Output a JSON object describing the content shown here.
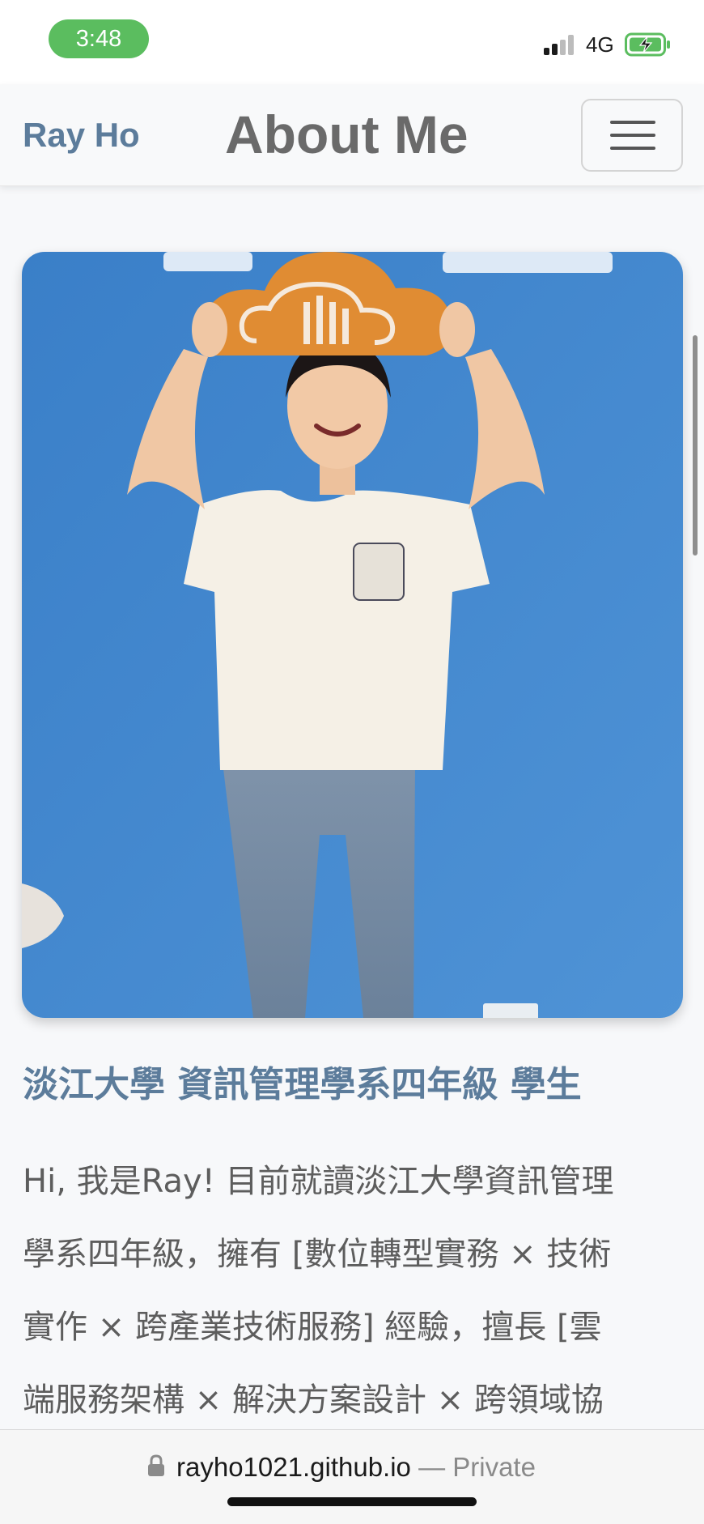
{
  "status_bar": {
    "time": "3:48",
    "network": "4G",
    "signal_icon": "cellular-signal-icon",
    "battery_icon": "battery-charging-icon",
    "time_pill_color": "#5bbd5f"
  },
  "navbar": {
    "brand": "Ray Ho",
    "title": "About Me",
    "menu_icon": "hamburger-menu-icon"
  },
  "profile": {
    "photo_description_icon": "profile-photo",
    "subtitle": "淡江大學 資訊管理學系四年級 學生",
    "bio_lines": [
      "Hi, 我是Ray! 目前就讀淡江大學資訊管理",
      "學系四年級，擁有 [數位轉型實務 × 技術",
      "實作 × 跨產業技術服務] 經驗，擅長 [雲",
      "端服務架構 × 解決方案設計 × 跨領域協"
    ]
  },
  "url_bar": {
    "domain": "rayho1021.github.io",
    "separator": " — ",
    "mode": "Private",
    "lock_icon": "lock-icon"
  },
  "colors": {
    "accent": "#5c7c9b",
    "wall_blue": "#3f86cf",
    "text": "#5d5d5d"
  }
}
